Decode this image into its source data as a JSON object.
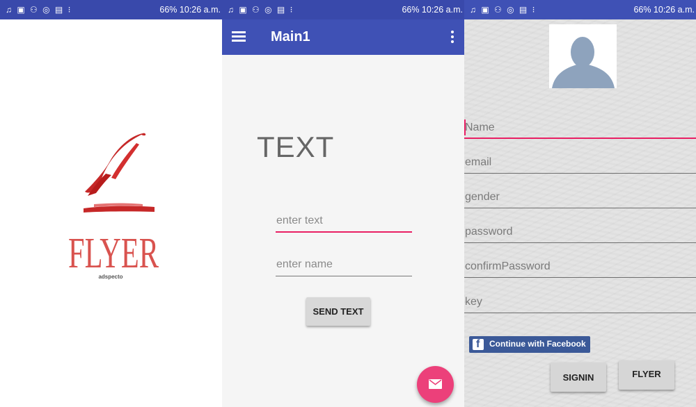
{
  "status_bar": {
    "left_icons": "♫ ▣ ⚇ ◎ ▤ ⁝",
    "right": "66% 10:26 a.m.",
    "battery_percent": "66%",
    "time": "10:26 a.m."
  },
  "splash": {
    "brand_name": "FLYER",
    "tagline": "adspecto"
  },
  "main": {
    "title": "Main1",
    "display_text": "TEXT",
    "text_field": {
      "placeholder": "enter text"
    },
    "name_field": {
      "placeholder": "enter name"
    },
    "send_button": "SEND TEXT"
  },
  "signup": {
    "fields": {
      "name": "Name",
      "email": "email",
      "gender": "gender",
      "password": "password",
      "confirm_password": "confirmPassword",
      "key": "key"
    },
    "facebook_button": "Continue with Facebook",
    "signin_button": "SIGNIN",
    "flyer_button": "FLYER"
  },
  "colors": {
    "primary": "#3f51b5",
    "accent": "#e91e63",
    "fab": "#ec407a",
    "facebook": "#3b5998"
  }
}
